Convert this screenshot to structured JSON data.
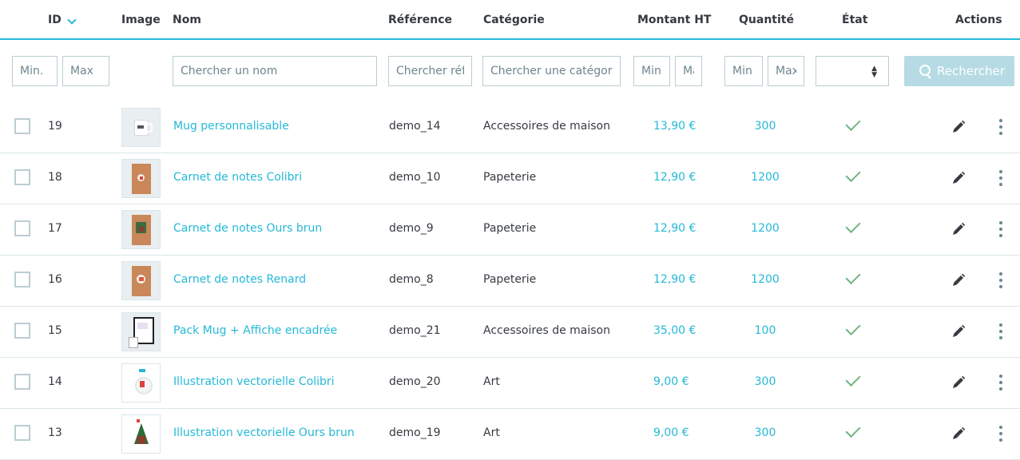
{
  "header": {
    "id": "ID",
    "image": "Image",
    "name": "Nom",
    "reference": "Référence",
    "category": "Catégorie",
    "price": "Montant HT",
    "quantity": "Quantité",
    "status": "État",
    "actions": "Actions",
    "sort_icon": "chevron-down-icon",
    "accent_color": "#25b9d7"
  },
  "filters": {
    "id_min": "Min.",
    "id_max": "Max",
    "name": "Chercher un nom",
    "reference": "Chercher référence",
    "category": "Chercher une catégorie",
    "price_min": "Min",
    "price_max": "Max",
    "qty_min": "Min",
    "qty_max": "Max",
    "status_value": "",
    "search_label": "Rechercher"
  },
  "products": [
    {
      "id": "19",
      "name": "Mug personnalisable",
      "reference": "demo_14",
      "category": "Accessoires de maison",
      "price": "13,90 €",
      "quantity": "300",
      "active": true,
      "thumb": "mug"
    },
    {
      "id": "18",
      "name": "Carnet de notes Colibri",
      "reference": "demo_10",
      "category": "Papeterie",
      "price": "12,90 €",
      "quantity": "1200",
      "active": true,
      "thumb": "notebook-colibri"
    },
    {
      "id": "17",
      "name": "Carnet de notes Ours brun",
      "reference": "demo_9",
      "category": "Papeterie",
      "price": "12,90 €",
      "quantity": "1200",
      "active": true,
      "thumb": "notebook-bear"
    },
    {
      "id": "16",
      "name": "Carnet de notes Renard",
      "reference": "demo_8",
      "category": "Papeterie",
      "price": "12,90 €",
      "quantity": "1200",
      "active": true,
      "thumb": "notebook-fox"
    },
    {
      "id": "15",
      "name": "Pack Mug + Affiche encadrée",
      "reference": "demo_21",
      "category": "Accessoires de maison",
      "price": "35,00 €",
      "quantity": "100",
      "active": true,
      "thumb": "pack"
    },
    {
      "id": "14",
      "name": "Illustration vectorielle Colibri",
      "reference": "demo_20",
      "category": "Art",
      "price": "9,00 €",
      "quantity": "300",
      "active": true,
      "thumb": "illus-colibri"
    },
    {
      "id": "13",
      "name": "Illustration vectorielle Ours brun",
      "reference": "demo_19",
      "category": "Art",
      "price": "9,00 €",
      "quantity": "300",
      "active": true,
      "thumb": "illus-bear"
    }
  ]
}
